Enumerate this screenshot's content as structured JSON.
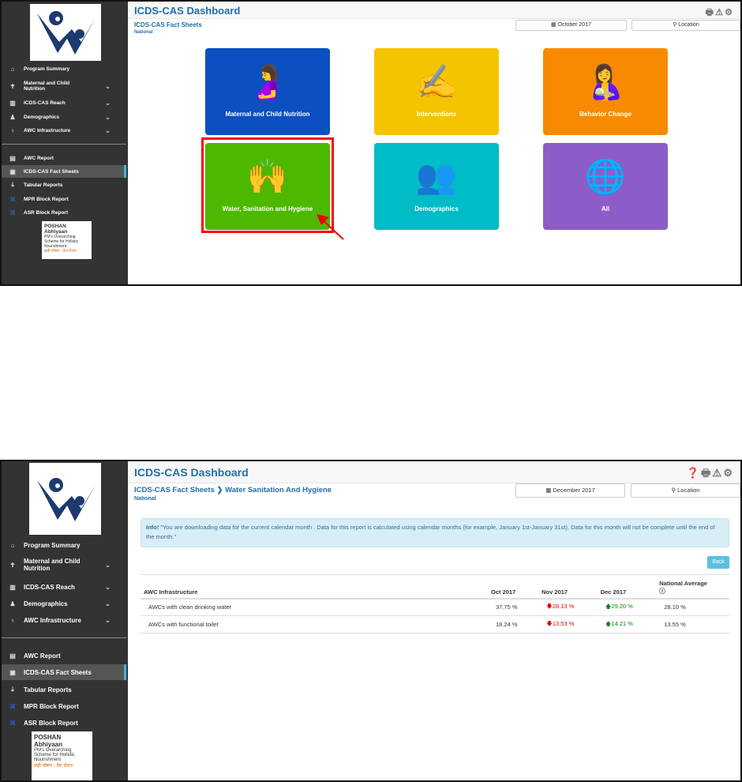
{
  "app_title": "ICDS-CAS Dashboard",
  "sidebar": {
    "items": [
      {
        "label": "Program Summary",
        "icon": "home-icon",
        "glyph": "⌂"
      },
      {
        "label": "Maternal and Child Nutrition",
        "icon": "pin-icon",
        "glyph": "✝",
        "chevron": true
      },
      {
        "label": "ICDS-CAS Reach",
        "icon": "bar-chart-icon",
        "glyph": "▥",
        "chevron": true
      },
      {
        "label": "Demographics",
        "icon": "users-icon",
        "glyph": "♟",
        "chevron": true
      },
      {
        "label": "AWC Infrastructure",
        "icon": "bulb-icon",
        "glyph": "♀",
        "chevron": true
      }
    ],
    "reports": [
      {
        "label": "AWC Report",
        "icon": "card-icon",
        "glyph": "▤"
      },
      {
        "label": "ICDS-CAS Fact Sheets",
        "icon": "file-icon",
        "glyph": "▣",
        "active": true
      },
      {
        "label": "Tabular Reports",
        "icon": "download-icon",
        "glyph": "⤓"
      },
      {
        "label": "MPR Block Report",
        "icon": "grid-icon",
        "glyph": "⌘"
      },
      {
        "label": "ASR Block Report",
        "icon": "grid-icon",
        "glyph": "⌘"
      }
    ],
    "poshan": {
      "line1": "POSHAN",
      "line2": "Abhiyaan",
      "line3": "PM's Overarching Scheme for Holistic Nourishment",
      "line4": "सही पोषण - देश रोशन"
    }
  },
  "screen1": {
    "breadcrumb": "ICDS-CAS Fact Sheets",
    "location_level": "National",
    "month": "October 2017",
    "location": "Location",
    "tiles": [
      {
        "label": "Maternal and Child Nutrition",
        "color": "#0b4fc0",
        "glyph": "🤰"
      },
      {
        "label": "Interventions",
        "color": "#f5c400",
        "glyph": "✍"
      },
      {
        "label": "Behavior Change",
        "color": "#f78a00",
        "glyph": "🤱"
      },
      {
        "label": "Water, Sanitation and Hygiene",
        "color": "#4cb800",
        "glyph": "🙌"
      },
      {
        "label": "Demographics",
        "color": "#00bcc6",
        "glyph": "👥"
      },
      {
        "label": "All",
        "color": "#8c5dc8",
        "glyph": "🌐"
      }
    ]
  },
  "screen2": {
    "breadcrumb_parent": "ICDS-CAS Fact Sheets",
    "breadcrumb_sep": "❯",
    "breadcrumb_current": "Water Sanitation And Hygiene",
    "location_level": "National",
    "month": "December 2017",
    "location": "Location",
    "info_label": "Info!",
    "info_text": " \"You are downloading data for the current calendar month . Data for this report is calculated using calendar months (for example, January 1st-January 31st). Data for this month will not be complete until the end of the month.\"",
    "back_label": "Back",
    "table": {
      "headers": [
        "AWC Infrastructure",
        "Oct 2017",
        "Nov 2017",
        "Dec 2017",
        "National Average"
      ],
      "rows": [
        {
          "name": "AWCs with clean drinking water",
          "oct": "37.75 %",
          "nov": "28.13 %",
          "nov_trend": "down",
          "dec": "29.20 %",
          "dec_trend": "up",
          "avg": "28.10 %"
        },
        {
          "name": "AWCs with functional toilet",
          "oct": "18.24 %",
          "nov": "13.53 %",
          "nov_trend": "down",
          "dec": "14.21 %",
          "dec_trend": "up",
          "avg": "13.55 %"
        }
      ]
    }
  }
}
